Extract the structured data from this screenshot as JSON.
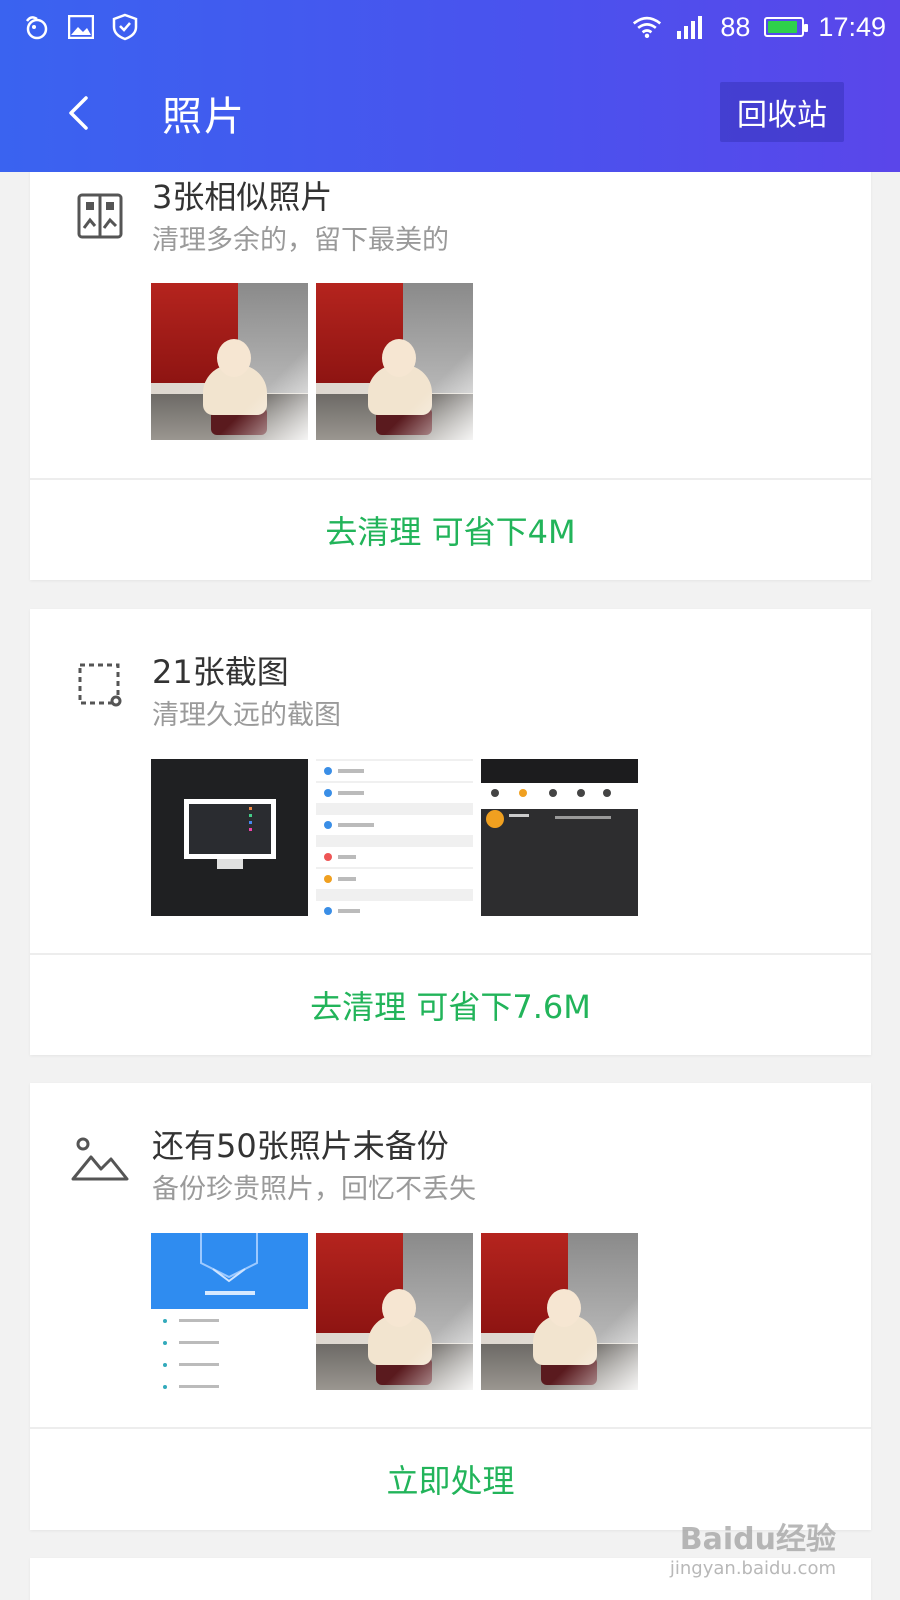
{
  "status_bar": {
    "battery_level": "88",
    "time": "17:49"
  },
  "header": {
    "title": "照片",
    "recycle_bin_label": "回收站"
  },
  "cards": [
    {
      "title": "3张相似照片",
      "subtitle": "清理多余的，留下最美的",
      "action_label": "去清理 可省下4M",
      "icon": "similar-photos-icon"
    },
    {
      "title": "21张截图",
      "subtitle": "清理久远的截图",
      "action_label": "去清理 可省下7.6M",
      "icon": "screenshot-icon"
    },
    {
      "title": "还有50张照片未备份",
      "subtitle": "备份珍贵照片，回忆不丢失",
      "action_label": "立即处理",
      "icon": "mountain-photo-icon"
    }
  ],
  "watermark": {
    "text": "Baidu经验",
    "url": "jingyan.baidu.com"
  },
  "colors": {
    "header_start": "#3a63f0",
    "header_end": "#5a46ea",
    "action_green": "#22b45a",
    "battery_green": "#2ed14b"
  }
}
